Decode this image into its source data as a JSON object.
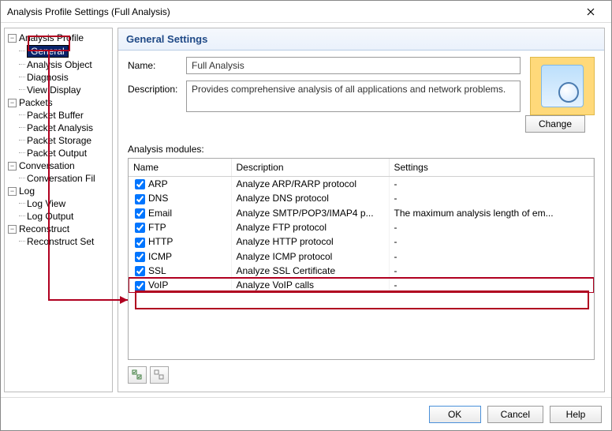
{
  "window": {
    "title": "Analysis Profile Settings (Full Analysis)"
  },
  "tree": {
    "groups": [
      {
        "label": "Analysis Profile",
        "children": [
          "General",
          "Analysis Object",
          "Diagnosis",
          "View Display"
        ]
      },
      {
        "label": "Packets",
        "children": [
          "Packet Buffer",
          "Packet Analysis",
          "Packet Storage",
          "Packet Output"
        ]
      },
      {
        "label": "Conversation",
        "children": [
          "Conversation Fil"
        ]
      },
      {
        "label": "Log",
        "children": [
          "Log View",
          "Log Output"
        ]
      },
      {
        "label": "Reconstruct",
        "children": [
          "Reconstruct Set"
        ]
      }
    ],
    "selected": "General"
  },
  "section": {
    "header": "General Settings",
    "name_label": "Name:",
    "name_value": "Full Analysis",
    "desc_label": "Description:",
    "desc_value": "Provides comprehensive analysis of all applications and network problems.",
    "change_label": "Change",
    "modules_label": "Analysis modules:"
  },
  "grid": {
    "headers": [
      "Name",
      "Description",
      "Settings"
    ],
    "rows": [
      {
        "checked": true,
        "name": "ARP",
        "desc": "Analyze ARP/RARP protocol",
        "settings": "-",
        "hl": false
      },
      {
        "checked": true,
        "name": "DNS",
        "desc": "Analyze DNS protocol",
        "settings": "-",
        "hl": false
      },
      {
        "checked": true,
        "name": "Email",
        "desc": "Analyze SMTP/POP3/IMAP4 p...",
        "settings": "The maximum analysis length of em...",
        "hl": false
      },
      {
        "checked": true,
        "name": "FTP",
        "desc": "Analyze FTP protocol",
        "settings": "-",
        "hl": false
      },
      {
        "checked": true,
        "name": "HTTP",
        "desc": "Analyze HTTP protocol",
        "settings": "-",
        "hl": false
      },
      {
        "checked": true,
        "name": "ICMP",
        "desc": "Analyze ICMP protocol",
        "settings": "-",
        "hl": false
      },
      {
        "checked": true,
        "name": "SSL",
        "desc": "Analyze SSL Certificate",
        "settings": "-",
        "hl": false
      },
      {
        "checked": true,
        "name": "VoIP",
        "desc": "Analyze VoIP calls",
        "settings": "-",
        "hl": true
      }
    ]
  },
  "buttons": {
    "ok": "OK",
    "cancel": "Cancel",
    "help": "Help"
  }
}
